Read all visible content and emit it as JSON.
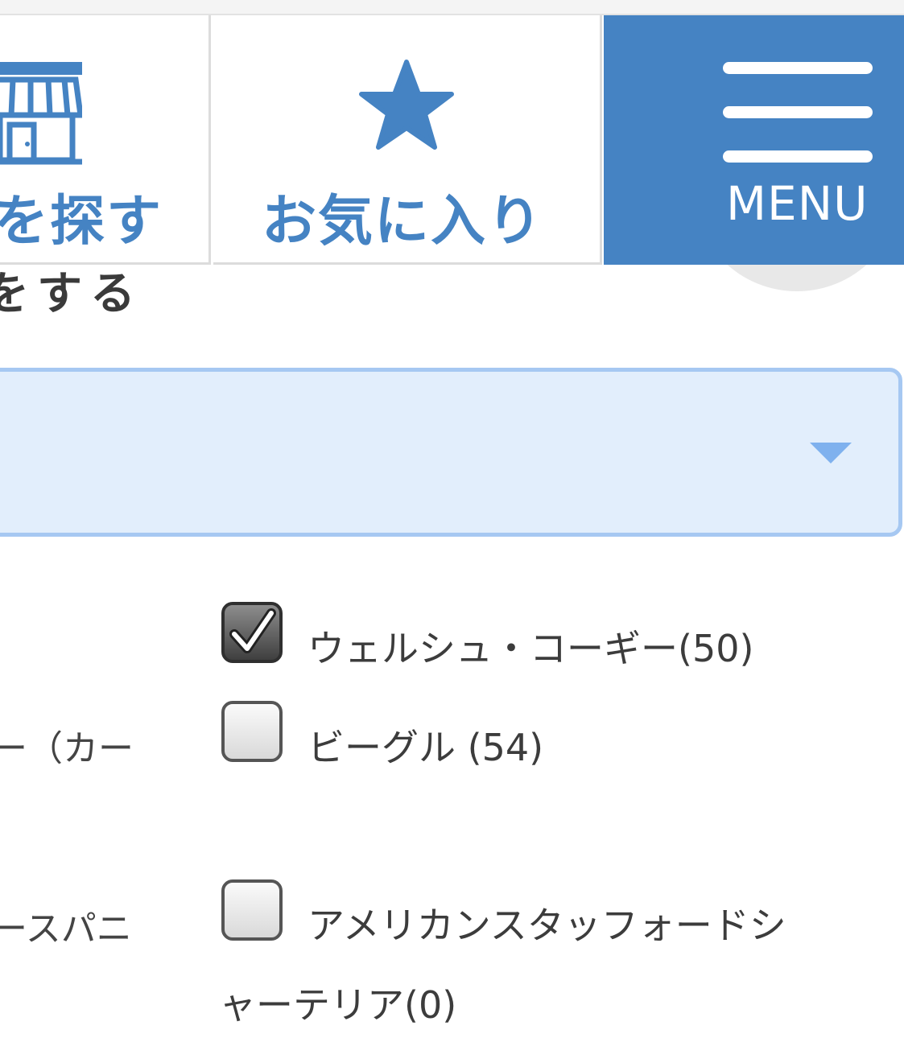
{
  "header": {
    "shop_label": "を探す",
    "favorite_label": "お気に入り",
    "menu_label": "MENU"
  },
  "heading_partial": "をする",
  "left_labels": [
    "ー（カー",
    "ースパニ"
  ],
  "breeds": [
    {
      "label": "ウェルシュ・コーギー(50)",
      "checked": true
    },
    {
      "label": "ビーグル (54)",
      "checked": false
    },
    {
      "label": "アメリカンスタッフォードシ",
      "label_cont": "ャーテリア(0)",
      "checked": false
    }
  ],
  "colors": {
    "brand": "#4583c3",
    "select_bg": "#e2eefc",
    "select_border": "#a6c8f2",
    "select_arrow": "#7fb1ee"
  }
}
